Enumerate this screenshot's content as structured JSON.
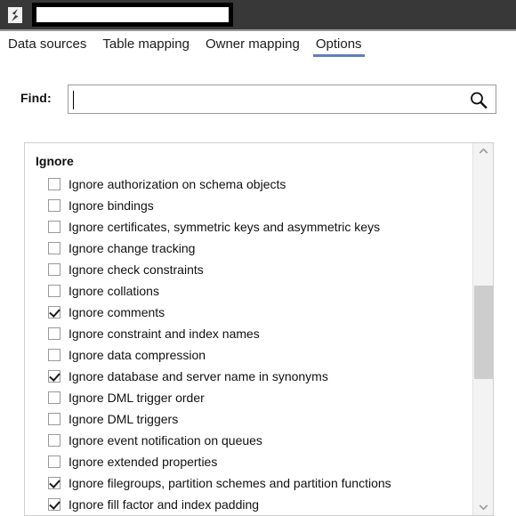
{
  "window": {
    "logo_icon": "app-logo-icon",
    "title_input_value": "",
    "title_input_placeholder": ""
  },
  "tabs": [
    {
      "label": "Data sources",
      "active": false
    },
    {
      "label": "Table mapping",
      "active": false
    },
    {
      "label": "Owner mapping",
      "active": false
    },
    {
      "label": "Options",
      "active": true
    }
  ],
  "find": {
    "label": "Find:",
    "value": "",
    "placeholder": "",
    "icon": "search-icon"
  },
  "options_group": {
    "header": "Ignore",
    "items": [
      {
        "label": "Ignore authorization on schema objects",
        "checked": false
      },
      {
        "label": "Ignore bindings",
        "checked": false
      },
      {
        "label": "Ignore certificates, symmetric keys and asymmetric keys",
        "checked": false
      },
      {
        "label": "Ignore change tracking",
        "checked": false
      },
      {
        "label": "Ignore check constraints",
        "checked": false
      },
      {
        "label": "Ignore collations",
        "checked": false
      },
      {
        "label": "Ignore comments",
        "checked": true
      },
      {
        "label": "Ignore constraint and index names",
        "checked": false
      },
      {
        "label": "Ignore data compression",
        "checked": false
      },
      {
        "label": "Ignore database and server name in synonyms",
        "checked": true
      },
      {
        "label": "Ignore DML trigger order",
        "checked": false
      },
      {
        "label": "Ignore DML triggers",
        "checked": false
      },
      {
        "label": "Ignore event notification on queues",
        "checked": false
      },
      {
        "label": "Ignore extended properties",
        "checked": false
      },
      {
        "label": "Ignore filegroups, partition schemes and partition functions",
        "checked": true
      },
      {
        "label": "Ignore fill factor and index padding",
        "checked": true
      }
    ]
  },
  "scrollbar": {
    "up_arrow": "chevron-up-icon",
    "down_arrow": "chevron-down-icon"
  },
  "colors": {
    "titlebar": "#383838",
    "accent": "#5b7fc7",
    "group_border": "#cfcfcf",
    "scroll_thumb": "#cdcdcd"
  }
}
